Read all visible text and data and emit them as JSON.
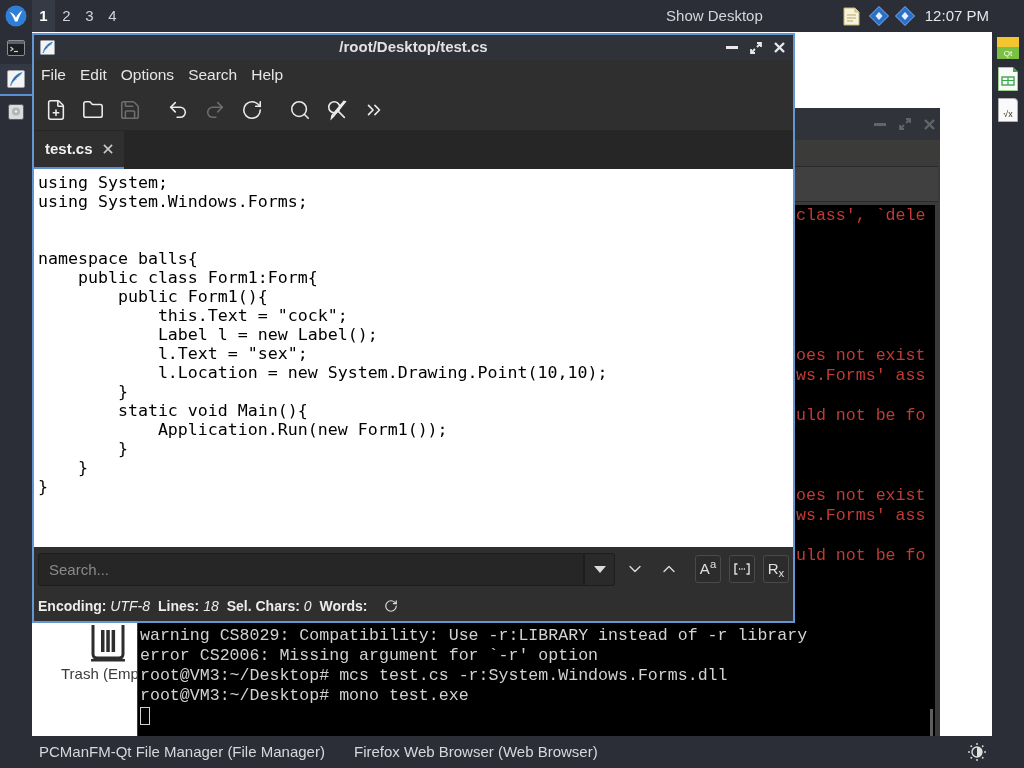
{
  "top_panel": {
    "workspaces": [
      {
        "label": "1",
        "selected": true
      },
      {
        "label": "2",
        "selected": false
      },
      {
        "label": "3",
        "selected": false
      },
      {
        "label": "4",
        "selected": false
      }
    ],
    "show_desktop": "Show Desktop",
    "clock": "12:07 PM"
  },
  "left_dock": [
    {
      "kind": "terminal",
      "selected": false
    },
    {
      "kind": "editor",
      "selected": true
    },
    {
      "kind": "drive",
      "selected": false
    }
  ],
  "right_dock": [
    {
      "kind": "qt",
      "label": "Qt"
    },
    {
      "kind": "spreadsheet"
    },
    {
      "kind": "formula",
      "label": "√x"
    }
  ],
  "desktop_icons": [
    {
      "kind": "trash",
      "label": "Trash (Emp"
    }
  ],
  "terminal": {
    "lines": [
      {
        "kind": "fragment",
        "text": "class', `dele"
      },
      {
        "kind": "blank"
      },
      {
        "kind": "blank"
      },
      {
        "kind": "blank"
      },
      {
        "kind": "blank"
      },
      {
        "kind": "blank"
      },
      {
        "kind": "blank"
      },
      {
        "kind": "fragment",
        "text": "oes not exist"
      },
      {
        "kind": "fragment",
        "text": "ws.Forms' ass"
      },
      {
        "kind": "blank"
      },
      {
        "kind": "fragment",
        "text": "uld not be fo"
      },
      {
        "kind": "blank"
      },
      {
        "kind": "blank"
      },
      {
        "kind": "blank"
      },
      {
        "kind": "fragment",
        "text": "oes not exist"
      },
      {
        "kind": "fragment",
        "text": "ws.Forms' ass"
      },
      {
        "kind": "blank"
      },
      {
        "kind": "fragment",
        "text": "uld not be fo"
      },
      {
        "kind": "blank"
      },
      {
        "kind": "blank"
      },
      {
        "kind": "blank"
      },
      {
        "kind": "output",
        "text": "warning CS8029: Compatibility: Use -r:LIBRARY instead of -r library"
      },
      {
        "kind": "output",
        "text": "error CS2006: Missing argument for `-r' option"
      },
      {
        "kind": "output",
        "text": "root@VM3:~/Desktop# mcs test.cs -r:System.Windows.Forms.dll"
      },
      {
        "kind": "output",
        "text": "root@VM3:~/Desktop# mono test.exe"
      },
      {
        "kind": "cursor"
      }
    ]
  },
  "editor": {
    "title": "/root/Desktop/test.cs",
    "menu": [
      "File",
      "Edit",
      "Options",
      "Search",
      "Help"
    ],
    "toolbar": [
      [
        {
          "kind": "new",
          "disabled": false
        },
        {
          "kind": "open",
          "disabled": false
        },
        {
          "kind": "save",
          "disabled": true
        }
      ],
      [
        {
          "kind": "undo",
          "disabled": false
        },
        {
          "kind": "redo",
          "disabled": true
        },
        {
          "kind": "reload",
          "disabled": false
        }
      ],
      [
        {
          "kind": "find",
          "disabled": false
        },
        {
          "kind": "replace",
          "disabled": false
        },
        {
          "kind": "more",
          "disabled": false
        }
      ]
    ],
    "tabs": [
      {
        "label": "test.cs",
        "selected": true
      }
    ],
    "code": "using System;\nusing System.Windows.Forms;\n\n\nnamespace balls{\n    public class Form1:Form{\n        public Form1(){\n            this.Text = \"cock\";\n            Label l = new Label();\n            l.Text = \"sex\";\n            l.Location = new System.Drawing.Point(10,10);\n        }\n        static void Main(){\n            Application.Run(new Form1());\n        }\n    }\n}",
    "search": {
      "placeholder": "Search...",
      "options": [
        {
          "kind": "match_case",
          "label": "A$^{a}$"
        },
        {
          "kind": "whole_word"
        },
        {
          "kind": "regex",
          "label": "R$_{x}$"
        }
      ]
    },
    "status": [
      {
        "label": "Encoding:",
        "value": "UTF-8"
      },
      {
        "label": "Lines:",
        "value": "18"
      },
      {
        "label": "Sel. Chars:",
        "value": "0"
      },
      {
        "label": "Words:"
      }
    ]
  },
  "taskbar": {
    "tasks": [
      "PCManFM-Qt File Manager (File Manager)",
      "Firefox Web Browser (Web Browser)"
    ]
  }
}
